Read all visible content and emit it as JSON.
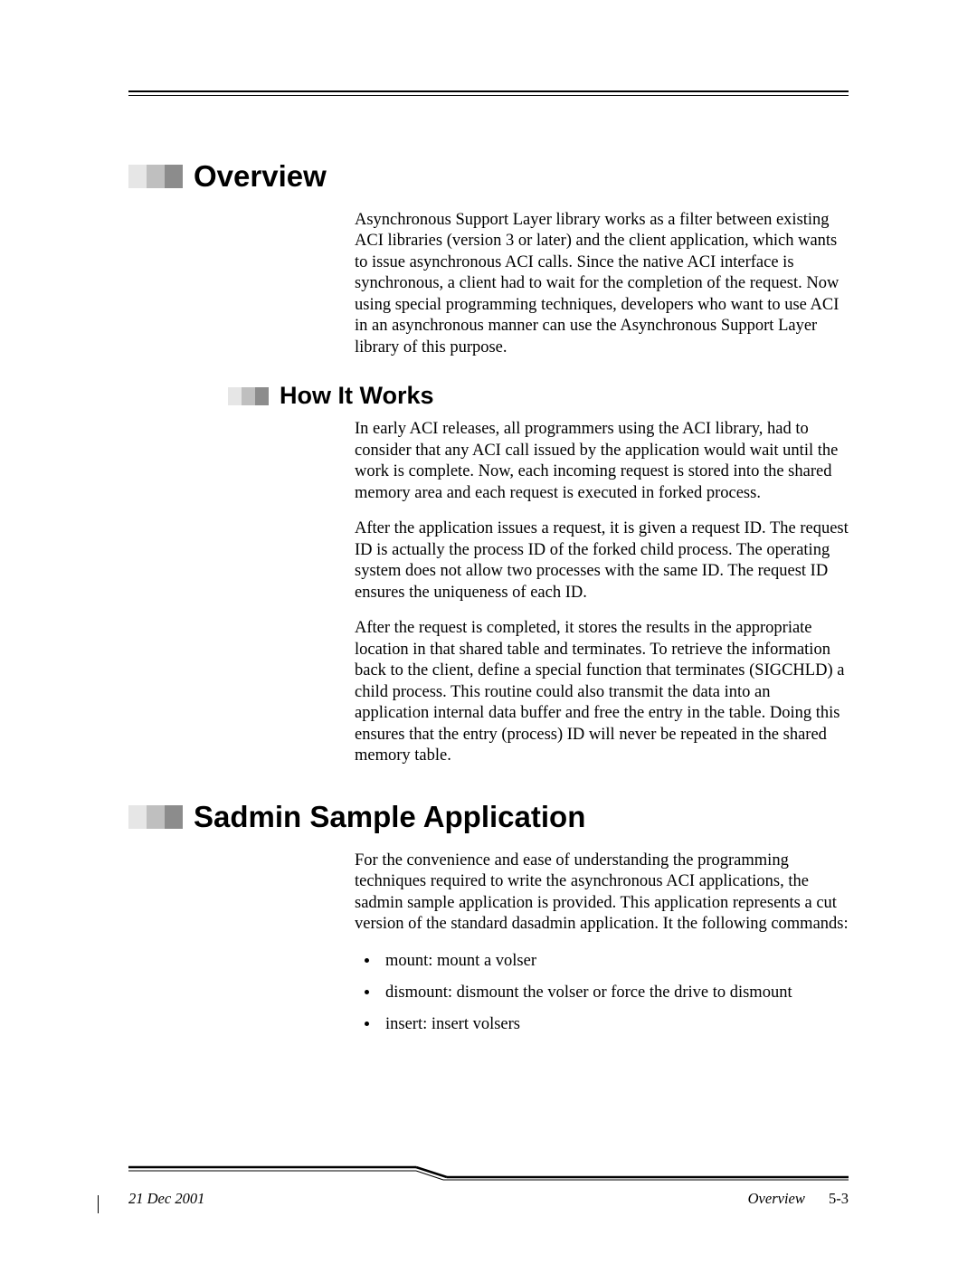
{
  "headings": {
    "overview": "Overview",
    "how_it_works": "How It Works",
    "sadmin": "Sadmin Sample Application"
  },
  "overview": {
    "p1": "Asynchronous Support Layer library works as a filter between existing ACI libraries (version 3 or later) and the client application, which wants to issue asynchronous ACI calls. Since the native ACI interface is synchronous, a client had to wait for the completion of the request. Now using special programming techniques, developers who want to use ACI in an asynchronous manner can use the Asynchronous Support Layer library of this purpose."
  },
  "how": {
    "p1": "In early ACI releases, all programmers using the ACI library, had to consider that any ACI call issued by the application would wait until the work is complete. Now, each incoming request is stored into the shared memory area and each request is executed in forked process.",
    "p2": "After the application issues a request, it is given a request ID. The request ID is actually the process ID of the forked child process. The operating system does not allow two processes with the same ID. The request ID ensures the uniqueness of each ID.",
    "p3": "After the request is completed, it stores the results in the appropriate location in that shared table and terminates. To retrieve the information back to the client, define a special function that terminates (SIGCHLD) a child process. This routine could also transmit the data into an application internal data buffer and free the entry in the table. Doing this ensures that the entry (process) ID will never be repeated in the shared memory table."
  },
  "sadmin": {
    "p1": "For the convenience and ease of understanding the programming techniques required to write the asynchronous ACI applications, the sadmin sample application is provided. This application represents a cut version of the standard dasadmin application. It the following commands:",
    "bullets": [
      "mount: mount a volser",
      "dismount: dismount the volser or force the drive to dismount",
      "insert: insert volsers"
    ]
  },
  "footer": {
    "date": "21 Dec 2001",
    "section": "Overview",
    "page": "5-3"
  }
}
